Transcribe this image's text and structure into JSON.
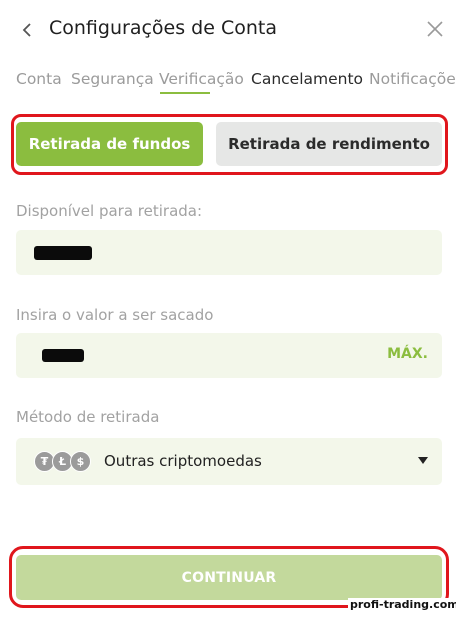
{
  "header": {
    "title": "Configurações de Conta",
    "back_icon": "chevron-left-icon",
    "close_icon": "close-icon"
  },
  "tabs": [
    {
      "label": "Conta",
      "active": false
    },
    {
      "label": "Segurança",
      "active": false
    },
    {
      "label": "Verificação",
      "active": true
    },
    {
      "label": "Cancelamento",
      "active": false
    },
    {
      "label": "Notificações",
      "active": false
    }
  ],
  "withdraw_type": {
    "options": [
      {
        "label": "Retirada de fundos",
        "selected": true
      },
      {
        "label": "Retirada de rendimento",
        "selected": false
      }
    ]
  },
  "available": {
    "label": "Disponível para retirada:",
    "value_redacted": true
  },
  "amount": {
    "label": "Insira o valor a ser sacado",
    "value_redacted": true,
    "max_label": "MÁX."
  },
  "method": {
    "label": "Método de retirada",
    "selected": "Outras criptomoedas",
    "coin_icons": [
      "tether-icon",
      "litecoin-icon",
      "usdc-icon"
    ]
  },
  "continue_label": "CONTINUAR",
  "watermark": "profi-trading.com",
  "colors": {
    "accent": "#8bbd3f",
    "accent_disabled": "#c3d99c",
    "field_bg": "#f3f7ea",
    "highlight": "#e0161c"
  }
}
